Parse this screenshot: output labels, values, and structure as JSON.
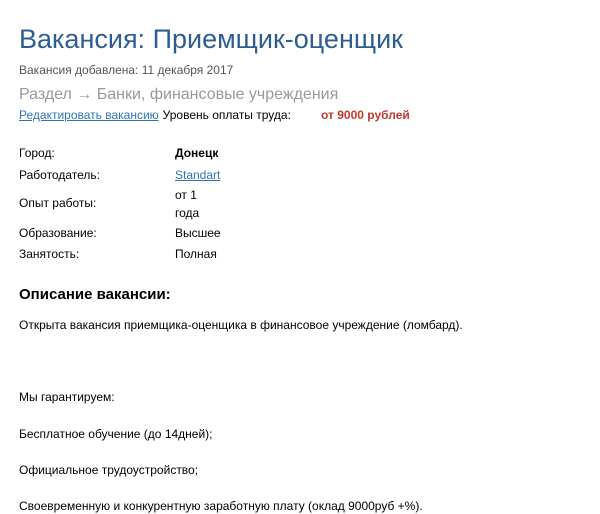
{
  "vacancy": {
    "title": "Вакансия: Приемщик-оценщик",
    "added": "Вакансия добавлена: 11 декабря 2017",
    "section": "Раздел → Банки, финансовые учреждения",
    "edit_link": "Редактировать вакансию",
    "pay_label": "Уровень оплаты труда:",
    "pay_value": "от 9000 рублей"
  },
  "props": {
    "city_label": "Город:",
    "city_value": "Донецк",
    "employer_label": "Работодатель:",
    "employer_value": "Standart",
    "experience_label": "Опыт работы:",
    "experience_value": "от 1 года",
    "education_label": "Образование:",
    "education_value": "Высшее",
    "employment_label": "Занятость:",
    "employment_value": "Полная"
  },
  "description": {
    "heading": "Описание вакансии:",
    "paragraphs": [
      "Открыта вакансия приемщика-оценщика в финансовое учреждение (ломбард).",
      "Мы гарантируем:",
      "Бесплатное обучение (до 14дней);",
      "Официальное трудоустройство;",
      "Своевременную и конкурентную заработную плату (оклад 9000руб +%)."
    ]
  },
  "colors": {
    "title": "#2e5d91",
    "link": "#2f73b8",
    "pay": "#c0392b",
    "muted": "#999999"
  }
}
